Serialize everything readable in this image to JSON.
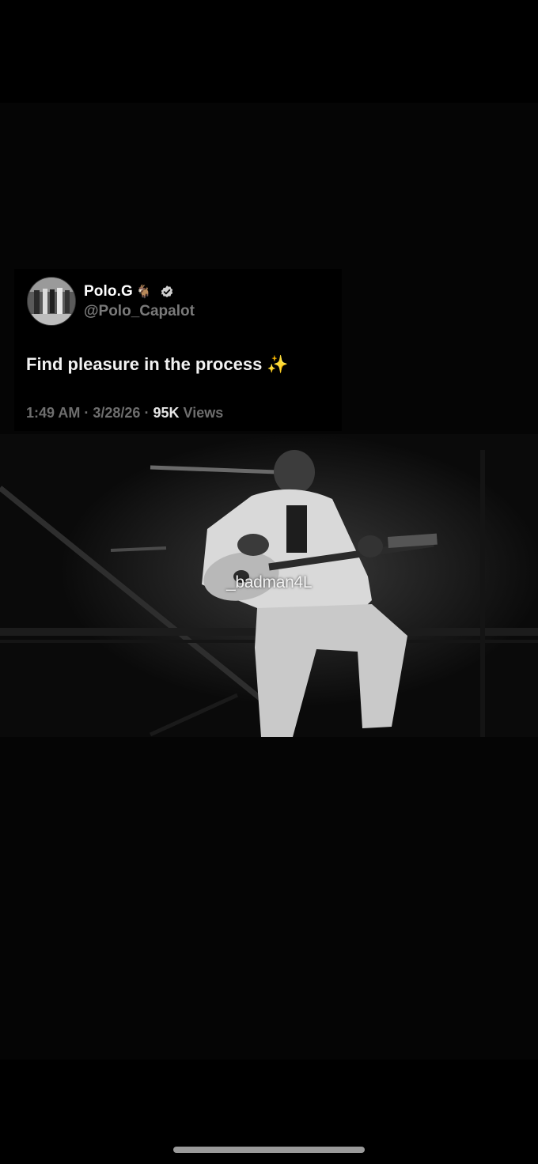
{
  "tweet": {
    "display_name": "Polo.G",
    "name_emoji": "🐐",
    "handle": "@Polo_Capalot",
    "text": "Find pleasure in the process ✨",
    "time": "1:49 AM",
    "date": "3/28/26",
    "separator": "·",
    "views_count": "95K",
    "views_label": "Views",
    "avatar_icon": "profile-photo",
    "verified_icon": "verified-badge-icon"
  },
  "video": {
    "watermark": "_badman4L",
    "description_icon": "video-frame"
  },
  "colors": {
    "background": "#000000",
    "handle": "#7a7a7a",
    "meta": "#6e6e6e",
    "views_count": "#e6e6e6",
    "home_indicator": "#9a9a9a"
  }
}
